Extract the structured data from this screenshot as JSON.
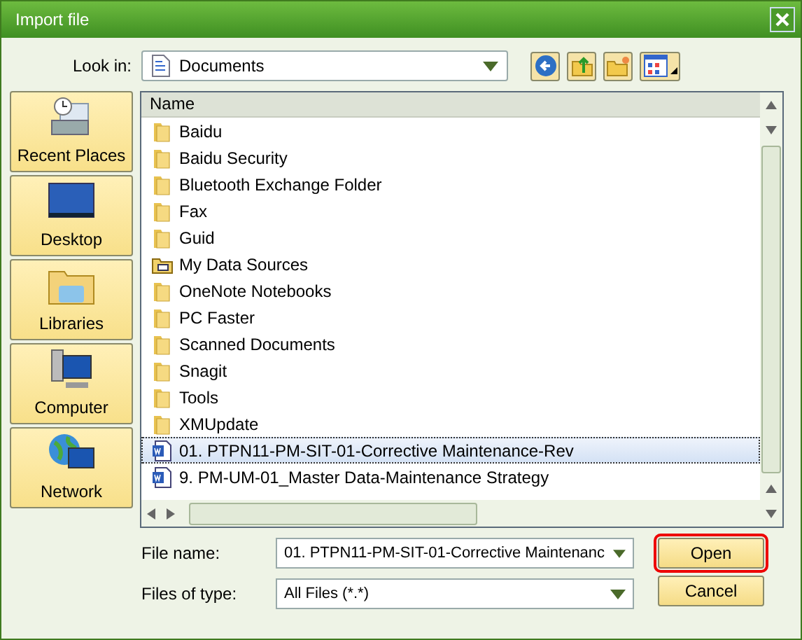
{
  "window": {
    "title": "Import file"
  },
  "look_in": {
    "label": "Look in:",
    "value": "Documents"
  },
  "places": [
    {
      "label": "Recent Places",
      "kind": "recent"
    },
    {
      "label": "Desktop",
      "kind": "desktop"
    },
    {
      "label": "Libraries",
      "kind": "libraries"
    },
    {
      "label": "Computer",
      "kind": "computer"
    },
    {
      "label": "Network",
      "kind": "network"
    }
  ],
  "file_list": {
    "column": "Name",
    "items": [
      {
        "name": "Baidu",
        "kind": "folder",
        "selected": false
      },
      {
        "name": "Baidu Security",
        "kind": "folder",
        "selected": false
      },
      {
        "name": "Bluetooth Exchange Folder",
        "kind": "folder",
        "selected": false
      },
      {
        "name": "Fax",
        "kind": "folder",
        "selected": false
      },
      {
        "name": "Guid",
        "kind": "folder",
        "selected": false
      },
      {
        "name": "My Data Sources",
        "kind": "datasource",
        "selected": false
      },
      {
        "name": "OneNote Notebooks",
        "kind": "folder",
        "selected": false
      },
      {
        "name": "PC Faster",
        "kind": "folder",
        "selected": false
      },
      {
        "name": "Scanned Documents",
        "kind": "folder",
        "selected": false
      },
      {
        "name": "Snagit",
        "kind": "folder",
        "selected": false
      },
      {
        "name": "Tools",
        "kind": "folder",
        "selected": false
      },
      {
        "name": "XMUpdate",
        "kind": "folder",
        "selected": false
      },
      {
        "name": "01. PTPN11-PM-SIT-01-Corrective Maintenance-Rev",
        "kind": "word",
        "selected": true
      },
      {
        "name": "9. PM-UM-01_Master Data-Maintenance Strategy",
        "kind": "word",
        "selected": false
      }
    ]
  },
  "file_name": {
    "label": "File name:",
    "value": "01. PTPN11-PM-SIT-01-Corrective Maintenanc"
  },
  "file_type": {
    "label": "Files of type:",
    "value": "All Files (*.*)"
  },
  "buttons": [
    {
      "label": "Open",
      "focused": true
    },
    {
      "label": "Cancel",
      "focused": false
    }
  ]
}
